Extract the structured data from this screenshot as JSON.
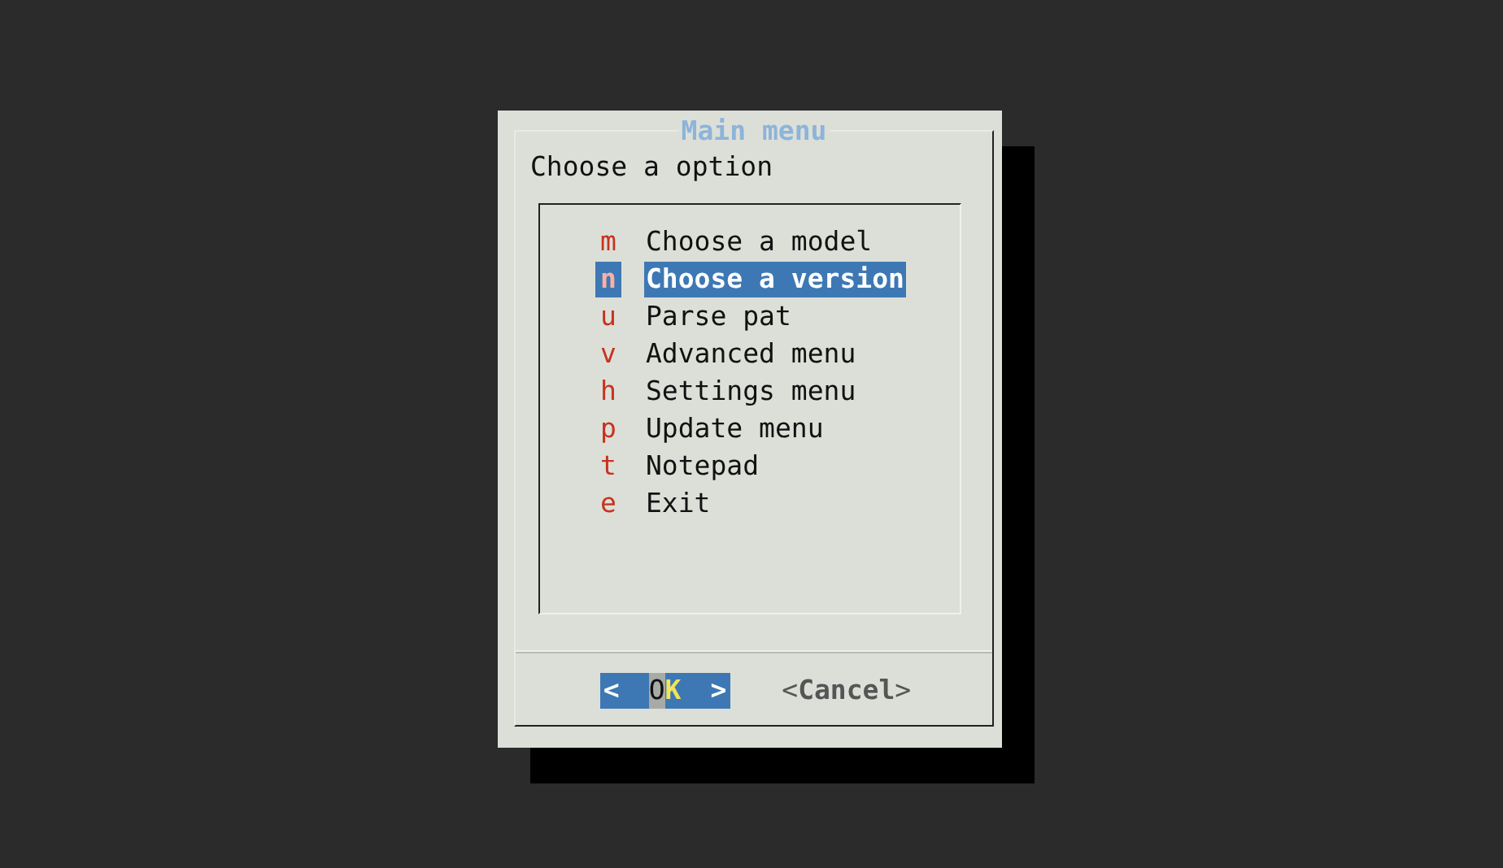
{
  "dialog": {
    "title": "Main menu",
    "prompt": "Choose a option"
  },
  "items": [
    {
      "key": "m",
      "label": "Choose a model",
      "selected": false
    },
    {
      "key": "n",
      "label": "Choose a version",
      "selected": true
    },
    {
      "key": "u",
      "label": "Parse pat",
      "selected": false
    },
    {
      "key": "v",
      "label": "Advanced menu",
      "selected": false
    },
    {
      "key": "h",
      "label": "Settings menu",
      "selected": false
    },
    {
      "key": "p",
      "label": "Update menu",
      "selected": false
    },
    {
      "key": "t",
      "label": "Notepad",
      "selected": false
    },
    {
      "key": "e",
      "label": "Exit",
      "selected": false
    }
  ],
  "buttons": [
    {
      "open": "<",
      "label": "OK",
      "close": ">",
      "selected": true
    },
    {
      "open": "<",
      "label": "Cancel",
      "close": ">",
      "selected": false
    }
  ]
}
